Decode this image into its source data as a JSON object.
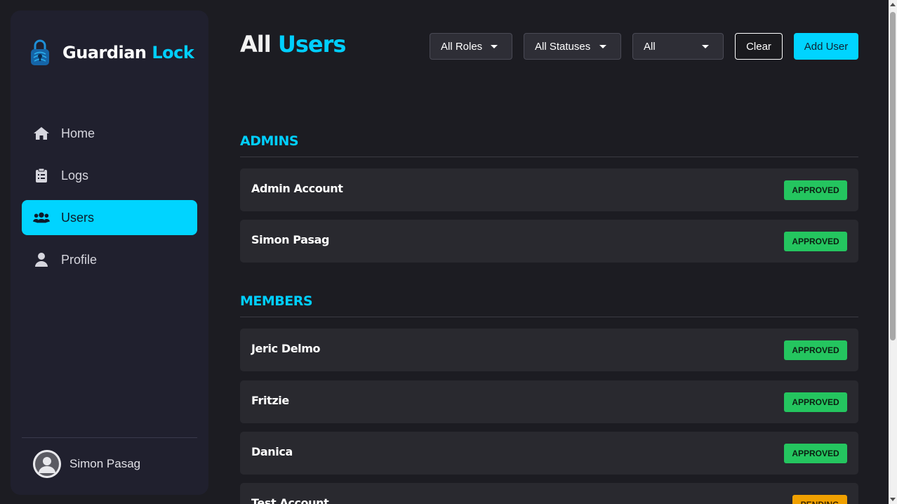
{
  "brand": {
    "name_part1": "Guardian",
    "name_part2": "Lock",
    "icon": "padlock-fingerprint-icon"
  },
  "sidebar": {
    "items": [
      {
        "label": "Home",
        "icon": "home-icon",
        "active": false
      },
      {
        "label": "Logs",
        "icon": "clipboard-icon",
        "active": false
      },
      {
        "label": "Users",
        "icon": "users-icon",
        "active": true
      },
      {
        "label": "Profile",
        "icon": "person-icon",
        "active": false
      }
    ],
    "user": {
      "name": "Simon Pasag",
      "avatar_icon": "avatar-icon"
    }
  },
  "header": {
    "title_part1": "All",
    "title_part2": "Users",
    "filters": {
      "roles": "All Roles",
      "statuses": "All Statuses",
      "other": "All"
    },
    "clear_label": "Clear",
    "add_label": "Add User"
  },
  "sections": [
    {
      "title": "ADMINS",
      "users": [
        {
          "name": "Admin Account",
          "status": "APPROVED"
        },
        {
          "name": "Simon Pasag",
          "status": "APPROVED"
        }
      ]
    },
    {
      "title": "MEMBERS",
      "users": [
        {
          "name": "Jeric Delmo",
          "status": "APPROVED"
        },
        {
          "name": "Fritzie",
          "status": "APPROVED"
        },
        {
          "name": "Danica",
          "status": "APPROVED"
        },
        {
          "name": "Test Account",
          "status": "PENDING"
        }
      ]
    }
  ],
  "colors": {
    "accent": "#00d4ff",
    "approved": "#24c55f",
    "pending": "#f0a000",
    "background": "#1c1c22",
    "sidebar": "#20202e",
    "card": "#29292f"
  }
}
